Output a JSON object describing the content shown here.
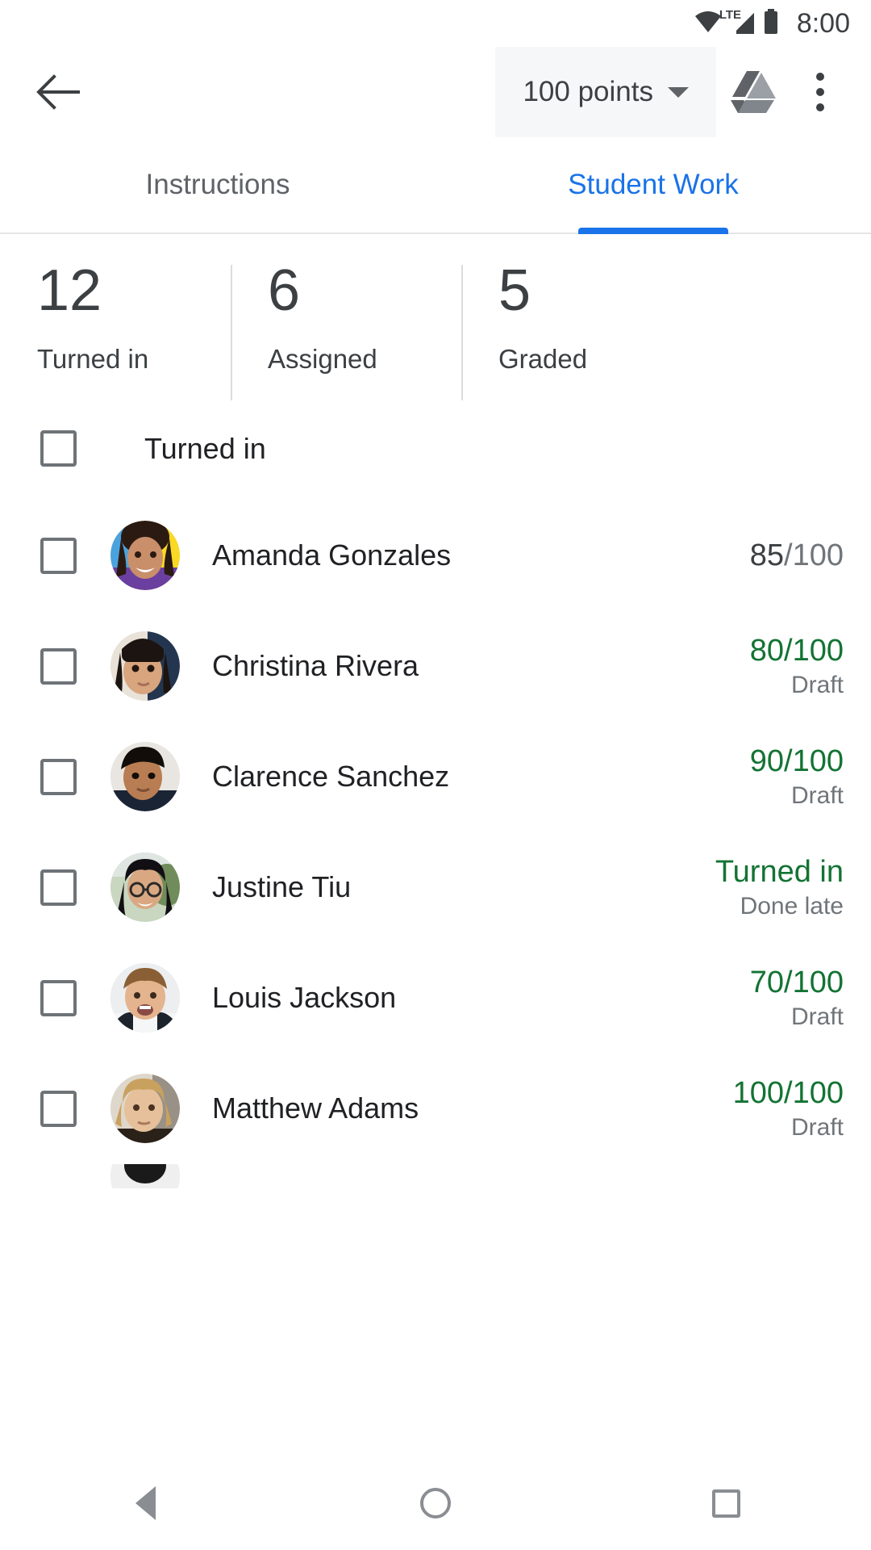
{
  "status_bar": {
    "time": "8:00",
    "network_label": "LTE",
    "icons": [
      "wifi-icon",
      "cellular-signal-icon",
      "battery-icon"
    ]
  },
  "toolbar": {
    "back_label": "Back",
    "points_label": "100 points",
    "drive_label": "Google Drive",
    "overflow_label": "More options"
  },
  "tabs": [
    {
      "label": "Instructions",
      "active": false
    },
    {
      "label": "Student Work",
      "active": true
    }
  ],
  "stats": [
    {
      "number": "12",
      "label": "Turned in"
    },
    {
      "number": "6",
      "label": "Assigned"
    },
    {
      "number": "5",
      "label": "Graded"
    }
  ],
  "section": {
    "title": "Turned in",
    "checked": false
  },
  "students": [
    {
      "name": "Amanda Gonzales",
      "grade": "85",
      "denominator": "/100",
      "status_color": "neutral",
      "sub": ""
    },
    {
      "name": "Christina Rivera",
      "grade": "80",
      "denominator": "/100",
      "status_color": "green",
      "sub": "Draft"
    },
    {
      "name": "Clarence Sanchez",
      "grade": "90",
      "denominator": "/100",
      "status_color": "green",
      "sub": "Draft"
    },
    {
      "name": "Justine Tiu",
      "grade": "Turned in",
      "denominator": "",
      "status_color": "green",
      "sub": "Done late"
    },
    {
      "name": "Louis Jackson",
      "grade": "70",
      "denominator": "/100",
      "status_color": "green",
      "sub": "Draft"
    },
    {
      "name": "Matthew Adams",
      "grade": "100",
      "denominator": "/100",
      "status_color": "green",
      "sub": "Draft"
    }
  ],
  "nav_bar": {
    "back": "Back",
    "home": "Home",
    "recents": "Recents"
  },
  "colors": {
    "accent_blue": "#1a73e8",
    "status_green": "#137333",
    "text_primary": "#202124",
    "text_secondary": "#70757a",
    "divider": "#dadce0"
  }
}
